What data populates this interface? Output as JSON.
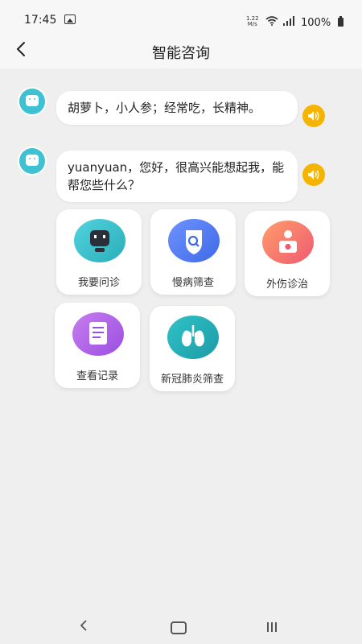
{
  "status": {
    "time": "17:45",
    "speed_value": "1.22",
    "speed_unit": "M/s",
    "battery": "100%"
  },
  "nav": {
    "title": "智能咨询"
  },
  "messages": [
    {
      "text": "胡萝卜，小人参；经常吃，长精神。"
    },
    {
      "text": "yuanyuan，您好，很高兴能想起我，能帮您些什么？"
    }
  ],
  "tiles": [
    {
      "label": "我要问诊",
      "icon": "robot-icon",
      "color": "#3ec2d3"
    },
    {
      "label": "慢病筛查",
      "icon": "shield-search-icon",
      "color": "#4a78f0"
    },
    {
      "label": "外伤诊治",
      "icon": "bandage-icon",
      "color": "#f06a6a"
    },
    {
      "label": "查看记录",
      "icon": "document-icon",
      "color": "#b566e6"
    },
    {
      "label": "新冠肺炎筛查",
      "icon": "lungs-icon",
      "color": "#2aaeb4"
    }
  ],
  "colors": {
    "speaker": "#f4b400",
    "avatar": "#3ec2d3"
  }
}
